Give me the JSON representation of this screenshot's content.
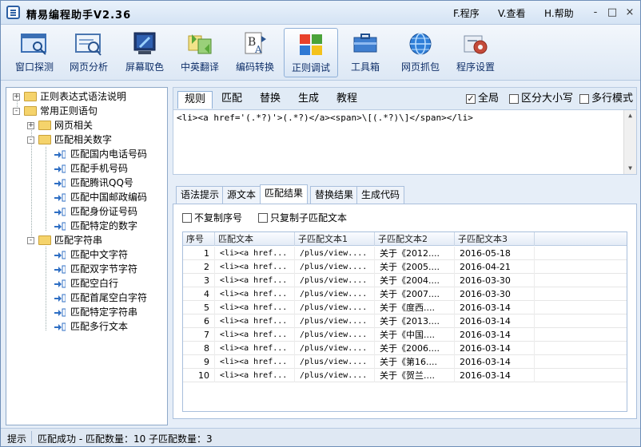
{
  "window": {
    "title": "精易编程助手V2.36",
    "menus": [
      "F.程序",
      "V.查看",
      "H.帮助"
    ],
    "controls": [
      "-",
      "□",
      "×"
    ]
  },
  "toolbar": {
    "items": [
      {
        "label": "窗口探测",
        "icon": "window-probe-icon"
      },
      {
        "label": "网页分析",
        "icon": "web-analyze-icon"
      },
      {
        "label": "屏幕取色",
        "icon": "color-picker-icon"
      },
      {
        "label": "中英翻译",
        "icon": "translate-icon"
      },
      {
        "label": "编码转换",
        "icon": "encoding-icon"
      },
      {
        "label": "正则调试",
        "icon": "regex-debug-icon",
        "active": true
      },
      {
        "label": "工具箱",
        "icon": "toolbox-icon"
      },
      {
        "label": "网页抓包",
        "icon": "packet-capture-icon"
      },
      {
        "label": "程序设置",
        "icon": "settings-icon"
      }
    ]
  },
  "tree": {
    "nodes": [
      {
        "label": "正则表达式语法说明",
        "level": 0,
        "kind": "folder",
        "toggle": "+"
      },
      {
        "label": "常用正则语句",
        "level": 0,
        "kind": "folder",
        "toggle": "-"
      },
      {
        "label": "网页相关",
        "level": 1,
        "kind": "folder",
        "toggle": "+"
      },
      {
        "label": "匹配相关数字",
        "level": 1,
        "kind": "folder",
        "toggle": "-"
      },
      {
        "label": "匹配国内电话号码",
        "level": 2,
        "kind": "leaf"
      },
      {
        "label": "匹配手机号码",
        "level": 2,
        "kind": "leaf"
      },
      {
        "label": "匹配腾讯QQ号",
        "level": 2,
        "kind": "leaf"
      },
      {
        "label": "匹配中国邮政编码",
        "level": 2,
        "kind": "leaf"
      },
      {
        "label": "匹配身份证号码",
        "level": 2,
        "kind": "leaf"
      },
      {
        "label": "匹配特定的数字",
        "level": 2,
        "kind": "leaf"
      },
      {
        "label": "匹配字符串",
        "level": 1,
        "kind": "folder",
        "toggle": "-"
      },
      {
        "label": "匹配中文字符",
        "level": 2,
        "kind": "leaf"
      },
      {
        "label": "匹配双字节字符",
        "level": 2,
        "kind": "leaf"
      },
      {
        "label": "匹配空白行",
        "level": 2,
        "kind": "leaf"
      },
      {
        "label": "匹配首尾空白字符",
        "level": 2,
        "kind": "leaf"
      },
      {
        "label": "匹配特定字符串",
        "level": 2,
        "kind": "leaf"
      },
      {
        "label": "匹配多行文本",
        "level": 2,
        "kind": "leaf"
      }
    ]
  },
  "top_tabs": [
    "规则",
    "匹配",
    "替换",
    "生成",
    "教程"
  ],
  "top_options": [
    {
      "label": "全局",
      "checked": true
    },
    {
      "label": "区分大小写",
      "checked": false
    },
    {
      "label": "多行模式",
      "checked": false
    }
  ],
  "regex_text": "<li><a href='(.*?)'>(.*?)</a><span>\\[(.*?)\\]</span></li>",
  "lower_tabs": [
    "语法提示",
    "源文本",
    "匹配结果",
    "替换结果",
    "生成代码"
  ],
  "result_options": [
    {
      "label": "不复制序号",
      "checked": false
    },
    {
      "label": "只复制子匹配文本",
      "checked": false
    }
  ],
  "table": {
    "headers": [
      "序号",
      "匹配文本",
      "子匹配文本1",
      "子匹配文本2",
      "子匹配文本3"
    ],
    "rows": [
      [
        "1",
        "<li><a href...",
        "/plus/view....",
        "关于《2012....",
        "2016-05-18"
      ],
      [
        "2",
        "<li><a href...",
        "/plus/view....",
        "关于《2005....",
        "2016-04-21"
      ],
      [
        "3",
        "<li><a href...",
        "/plus/view....",
        "关于《2004....",
        "2016-03-30"
      ],
      [
        "4",
        "<li><a href...",
        "/plus/view....",
        "关于《2007....",
        "2016-03-30"
      ],
      [
        "5",
        "<li><a href...",
        "/plus/view....",
        "关于《度西....",
        "2016-03-14"
      ],
      [
        "6",
        "<li><a href...",
        "/plus/view....",
        "关于《2013....",
        "2016-03-14"
      ],
      [
        "7",
        "<li><a href...",
        "/plus/view....",
        "关于《中国....",
        "2016-03-14"
      ],
      [
        "8",
        "<li><a href...",
        "/plus/view....",
        "关于《2006....",
        "2016-03-14"
      ],
      [
        "9",
        "<li><a href...",
        "/plus/view....",
        "关于《第16....",
        "2016-03-14"
      ],
      [
        "10",
        "<li><a href...",
        "/plus/view....",
        "关于《贺兰....",
        "2016-03-14"
      ]
    ]
  },
  "status": {
    "hint": "提示",
    "message": "匹配成功 - 匹配数量：10   子匹配数量：3"
  }
}
